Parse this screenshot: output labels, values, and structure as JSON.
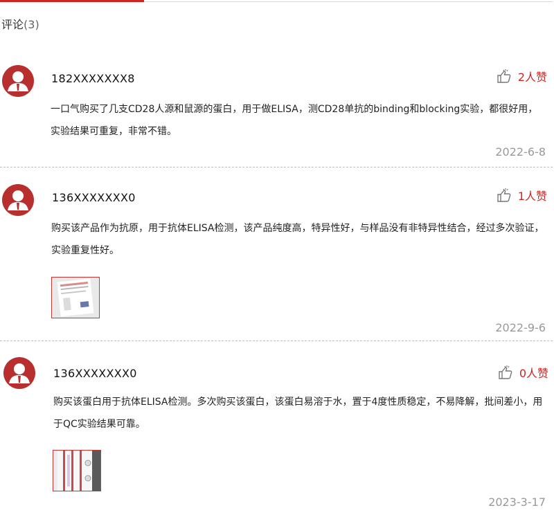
{
  "section": {
    "title": "评论",
    "count_text": "(3)"
  },
  "comments": [
    {
      "user": "182XXXXXXX8",
      "likes": "2人赞",
      "text": "一口气购买了几支CD28人源和鼠源的蛋白，用于做ELISA，测CD28单抗的binding和blocking实验，都很好用，实验结果可重复，非常不错。",
      "date": "2022-6-8"
    },
    {
      "user": "136XXXXXXX0",
      "likes": "1人赞",
      "text": "购买该产品作为抗原，用于抗体ELISA检测，该产品纯度高，特异性好，与样品没有非特异性结合，经过多次验证，实验重复性好。",
      "date": "2022-9-6"
    },
    {
      "user": "136XXXXXXX0",
      "likes": "0人赞",
      "text": "购买该蛋白用于抗体ELISA检测。多次购买该蛋白，该蛋白易溶于水，置于4度性质稳定，不易降解，批间差小，用于QC实验结果可靠。",
      "date": "2023-3-17"
    }
  ],
  "colors": {
    "accent": "#d0231f",
    "avatar": "#b82f2f",
    "date": "#999999"
  },
  "icons": {
    "like": "thumbs-up-icon",
    "avatar": "user-avatar-icon"
  }
}
